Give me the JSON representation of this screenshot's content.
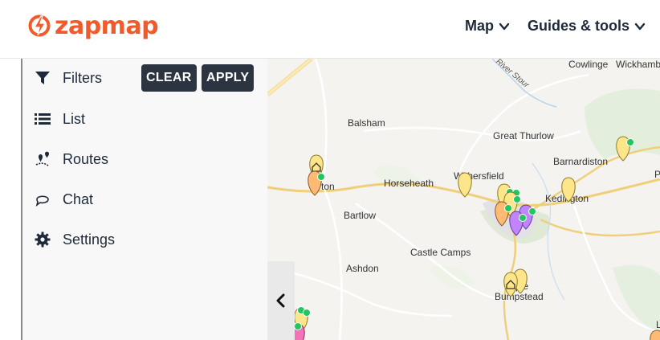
{
  "header": {
    "logo_text": "zapmap",
    "nav": [
      {
        "label": "Map"
      },
      {
        "label": "Guides & tools"
      }
    ]
  },
  "sidebar": {
    "filters_label": "Filters",
    "clear_label": "CLEAR",
    "apply_label": "APPLY",
    "items": [
      {
        "label": "List",
        "icon": "list-icon"
      },
      {
        "label": "Routes",
        "icon": "routes-icon"
      },
      {
        "label": "Chat",
        "icon": "chat-icon"
      },
      {
        "label": "Settings",
        "icon": "gear-icon"
      }
    ]
  },
  "map": {
    "places": [
      "Cowlinge",
      "Wickhamb",
      "River Stour",
      "Balsham",
      "Great Thurlow",
      "Barnardiston",
      "Withersfield",
      "Horseheath",
      "ton",
      "Kedington",
      "Bartlow",
      "Castle Camps",
      "Ashdon",
      "ple",
      "Bumpstead",
      "P",
      "L"
    ]
  },
  "colors": {
    "brand": "#f15a2b",
    "button_bg": "#2b3440",
    "pin_yellow": "#fde68a",
    "pin_orange": "#fdba74",
    "pin_purple": "#c084fc",
    "pin_pink": "#f472b6",
    "check_green": "#22c55e"
  }
}
